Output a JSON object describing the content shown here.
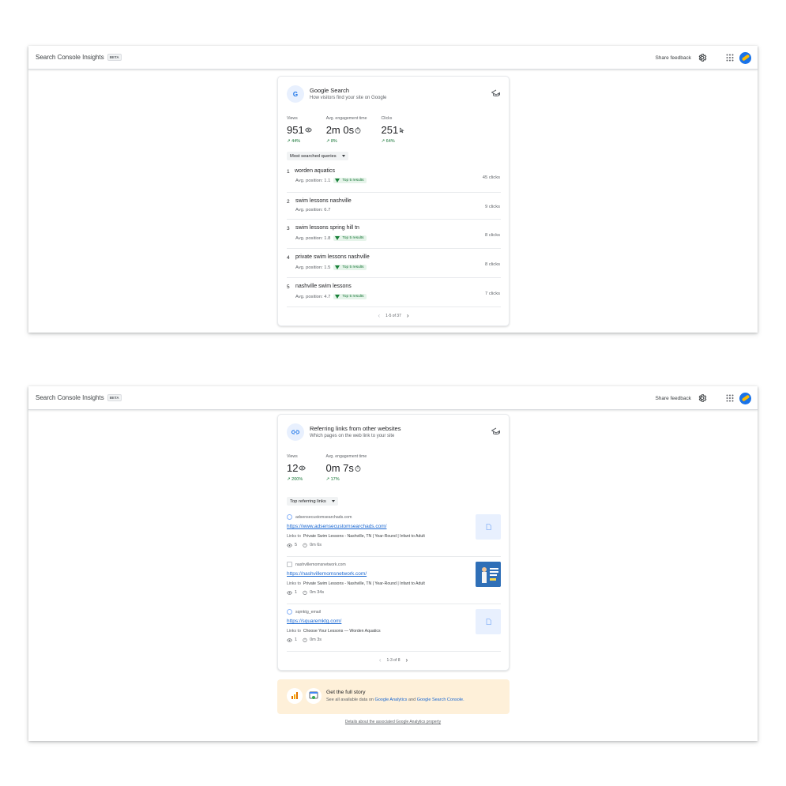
{
  "app": {
    "title": "Search Console Insights",
    "beta": "BETA",
    "share_feedback": "Share feedback",
    "icons": {
      "settings": "gear-icon",
      "apps": "apps-grid-icon",
      "account": "avatar"
    }
  },
  "google_search": {
    "icon_letter": "G",
    "title": "Google Search",
    "subtitle": "How visitors find your site on Google",
    "metrics": [
      {
        "label": "Views",
        "value": "951",
        "icon": "eye-icon",
        "delta": "44%"
      },
      {
        "label": "Avg. engagement time",
        "value": "2m 0s",
        "icon": "timer-icon",
        "delta": "8%"
      },
      {
        "label": "Clicks",
        "value": "251",
        "icon": "cursor-icon",
        "delta": "64%"
      }
    ],
    "dropdown": "Most searched queries",
    "queries": [
      {
        "rank": "1",
        "query": "worden aquatics",
        "position": "Avg. position: 1.1",
        "badge": "Top 5 results",
        "clicks": "45 clicks"
      },
      {
        "rank": "2",
        "query": "swim lessons nashville",
        "position": "Avg. position: 6.7",
        "badge": "",
        "clicks": "9 clicks"
      },
      {
        "rank": "3",
        "query": "swim lessons spring hill tn",
        "position": "Avg. position: 1.8",
        "badge": "Top 5 results",
        "clicks": "8 clicks"
      },
      {
        "rank": "4",
        "query": "private swim lessons nashville",
        "position": "Avg. position: 1.5",
        "badge": "Top 5 results",
        "clicks": "8 clicks"
      },
      {
        "rank": "5",
        "query": "nashville swim lessons",
        "position": "Avg. position: 4.7",
        "badge": "Top 5 results",
        "clicks": "7 clicks"
      }
    ],
    "pager": "1-5 of 37"
  },
  "referring": {
    "title": "Referring links from other websites",
    "subtitle": "Which pages on the web link to your site",
    "metrics": [
      {
        "label": "Views",
        "value": "12",
        "icon": "eye-icon",
        "delta": "200%"
      },
      {
        "label": "Avg. engagement time",
        "value": "0m 7s",
        "icon": "timer-icon",
        "delta": "17%"
      }
    ],
    "dropdown": "Top referring links",
    "links_to_label": "Links to",
    "items": [
      {
        "domain": "adsensecustomsearchads.com",
        "url": "https://www.adsensecustomsearchads.com/",
        "links_to": "Private Swim Lessons - Nashville, TN | Year-Round | Infant to Adult",
        "views": "5",
        "time": "0m 6s"
      },
      {
        "domain": "nashvillemomsnetwork.com",
        "url": "https://nashvillemomsnetwork.com/",
        "links_to": "Private Swim Lessons - Nashville, TN | Year-Round | Infant to Adult",
        "views": "1",
        "time": "0m 34s"
      },
      {
        "domain": "sqmktg_email",
        "url": "https://squaremktg.com/",
        "links_to": "Choose Your Lessons — Worden Aquatics",
        "views": "1",
        "time": "0m 3s"
      }
    ],
    "pager": "1-3 of 8"
  },
  "promo": {
    "title": "Get the full story",
    "sub_prefix": "See all available data on",
    "ga": "Google Analytics",
    "and": "and",
    "gsc": "Google Search Console."
  },
  "footer_link": "Details about the associated Google Analytics property",
  "colors": {
    "accent": "#1a73e8",
    "positive": "#137333",
    "promo_bg": "#fef0d9"
  }
}
